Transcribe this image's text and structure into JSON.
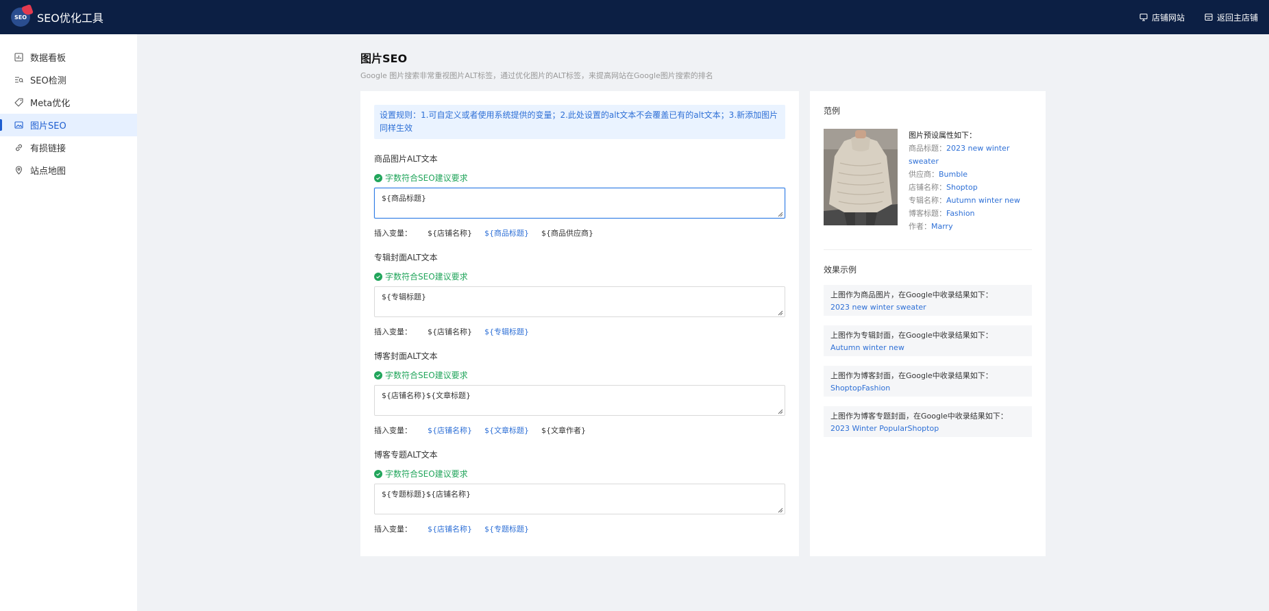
{
  "app": {
    "title": "SEO优化工具",
    "logo_text": "SEO"
  },
  "top_actions": [
    {
      "label": "店铺网站",
      "icon": "monitor-icon"
    },
    {
      "label": "返回主店铺",
      "icon": "store-icon"
    }
  ],
  "sidebar": {
    "items": [
      {
        "label": "数据看板",
        "icon": "chart-icon",
        "active": false
      },
      {
        "label": "SEO检测",
        "icon": "seo-check-icon",
        "active": false
      },
      {
        "label": "Meta优化",
        "icon": "tag-icon",
        "active": false
      },
      {
        "label": "图片SEO",
        "icon": "image-icon",
        "active": true
      },
      {
        "label": "有损链接",
        "icon": "link-icon",
        "active": false
      },
      {
        "label": "站点地图",
        "icon": "location-icon",
        "active": false
      }
    ]
  },
  "page": {
    "title": "图片SEO",
    "subtitle": "Google 图片搜索非常重视图片ALT标签，通过优化图片的ALT标签，来提高网站在Google图片搜索的排名"
  },
  "notice": "设置规则：1.可自定义或者使用系统提供的变量；2.此处设置的alt文本不会覆盖已有的alt文本；3.新添加图片同样生效",
  "ok_text": "字数符合SEO建议要求",
  "insert_label": "插入变量：",
  "fields": [
    {
      "label": "商品图片ALT文本",
      "value": "${商品标题}",
      "vars": [
        "${店铺名称}",
        "${商品标题}",
        "${商品供应商}"
      ],
      "highlight": [
        false,
        true,
        false
      ],
      "focused": true
    },
    {
      "label": "专辑封面ALT文本",
      "value": "${专辑标题}",
      "vars": [
        "${店铺名称}",
        "${专辑标题}"
      ],
      "highlight": [
        false,
        true
      ],
      "focused": false
    },
    {
      "label": "博客封面ALT文本",
      "value": "${店铺名称}${文章标题}",
      "vars": [
        "${店铺名称}",
        "${文章标题}",
        "${文章作者}"
      ],
      "highlight": [
        true,
        true,
        false
      ],
      "focused": false
    },
    {
      "label": "博客专题ALT文本",
      "value": "${专题标题}${店铺名称}",
      "vars": [
        "${店铺名称}",
        "${专题标题}"
      ],
      "highlight": [
        true,
        true
      ],
      "focused": false
    }
  ],
  "example": {
    "title": "范例",
    "attrs_heading": "图片预设属性如下：",
    "attrs": [
      {
        "k": "商品标题：",
        "v": "2023 new winter sweater"
      },
      {
        "k": "供应商：",
        "v": "Bumble"
      },
      {
        "k": "店铺名称：",
        "v": "Shoptop"
      },
      {
        "k": "专辑名称：",
        "v": "Autumn winter new"
      },
      {
        "k": "博客标题：",
        "v": "Fashion"
      },
      {
        "k": "作者：",
        "v": "Marry"
      }
    ]
  },
  "effects": {
    "title": "效果示例",
    "items": [
      {
        "text": "上图作为商品图片，在Google中收录结果如下：",
        "result": "2023 new winter sweater"
      },
      {
        "text": "上图作为专辑封面，在Google中收录结果如下：",
        "result": "Autumn winter new"
      },
      {
        "text": "上图作为博客封面，在Google中收录结果如下：",
        "result": "ShoptopFashion"
      },
      {
        "text": "上图作为博客专题封面，在Google中收录结果如下：",
        "result": "2023 Winter PopularShoptop"
      }
    ]
  },
  "colors": {
    "topbar": "#0c1f44",
    "accent": "#1e5ed0",
    "success": "#21a55b",
    "link": "#2d6fd6"
  }
}
